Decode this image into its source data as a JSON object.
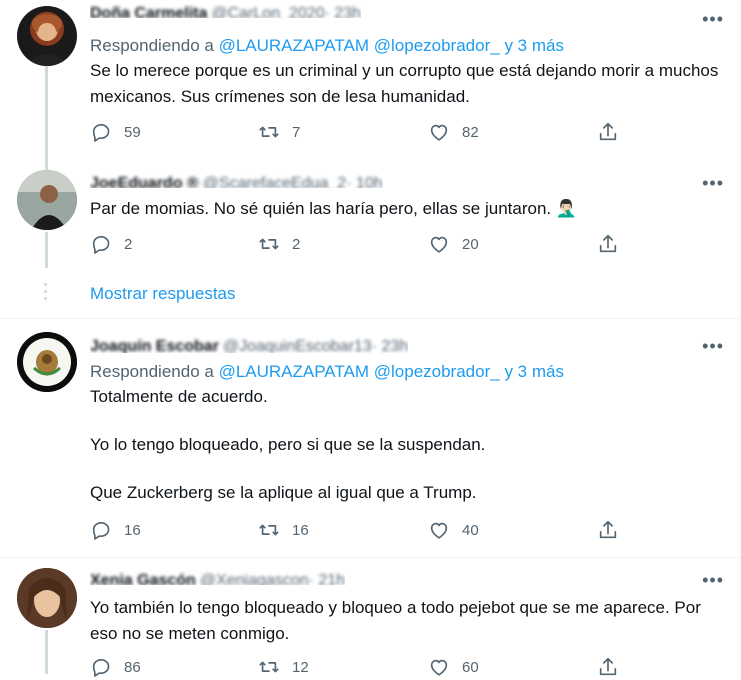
{
  "tweets": [
    {
      "name": "Doña Carmelita",
      "handle": "@CarLon_2020",
      "time": "· 23h",
      "reply_prefix": "Respondiendo a",
      "mentions": [
        "@LAURAZAPATAM",
        "@lopezobrador_"
      ],
      "reply_suffix": "y 3 más",
      "text": [
        "Se lo merece porque es un criminal y un corrupto que está dejando morir a muchos mexicanos. Sus crímenes son de lesa humanidad."
      ],
      "replies": "59",
      "retweets": "7",
      "likes": "82"
    },
    {
      "name": "JoeEduardo ®",
      "handle": "@ScarefaceEdua_2",
      "time": "· 10h",
      "text": [
        "Par de momias. No sé quién las haría pero, ellas se juntaron. 🤦🏻‍♂️"
      ],
      "replies": "2",
      "retweets": "2",
      "likes": "20"
    },
    {
      "name": "Joaquín Escobar",
      "handle": "@JoaquinEscobar13",
      "time": "· 23h",
      "reply_prefix": "Respondiendo a",
      "mentions": [
        "@LAURAZAPATAM",
        "@lopezobrador_"
      ],
      "reply_suffix": "y 3 más",
      "text": [
        "Totalmente de acuerdo.",
        "Yo lo tengo bloqueado, pero si que se la suspendan.",
        "Que Zuckerberg se la aplique al igual que a Trump."
      ],
      "replies": "16",
      "retweets": "16",
      "likes": "40"
    },
    {
      "name": "Xenia Gascón",
      "handle": "@Xeniagascon",
      "time": "· 21h",
      "text": [
        "Yo también lo tengo bloqueado y bloqueo a todo pejebot que se me aparece. Por eso no se meten conmigo."
      ],
      "replies": "86",
      "retweets": "12",
      "likes": "60"
    }
  ],
  "show_replies_label": "Mostrar respuestas",
  "more_label": "•••",
  "colors": {
    "accent": "#1d9bf0",
    "secondary_text": "#536471",
    "line": "#cfd9de"
  }
}
